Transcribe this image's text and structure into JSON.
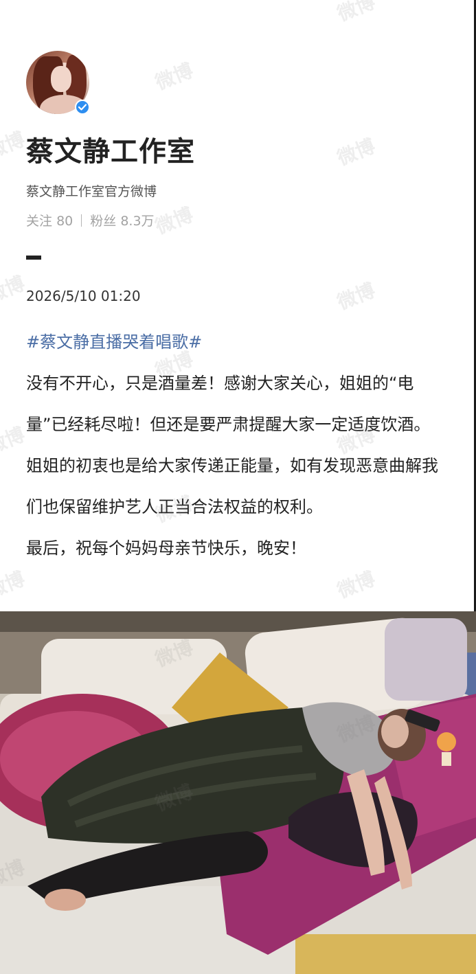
{
  "profile": {
    "name": "蔡文静工作室",
    "bio": "蔡文静工作室官方微博",
    "following_label": "关注",
    "following_count": "80",
    "fans_label": "粉丝",
    "fans_count": "8.3万"
  },
  "post": {
    "datetime": "2026/5/10 01:20",
    "hashtag": "#蔡文静直播哭着唱歌#",
    "paragraphs": [
      "没有不开心，只是酒量差！感谢大家关心，姐姐的“电量”已经耗尽啦！但还是要严肃提醒大家一定适度饮酒。",
      "姐姐的初衷也是给大家传递正能量，如有发现恶意曲解我们也保留维护艺人正当合法权益的权利。",
      "最后，祝每个妈妈母亲节快乐，晚安！"
    ]
  },
  "watermark": "微博",
  "icons": {
    "verified": "verified-badge-icon",
    "avatar": "avatar"
  },
  "colors": {
    "hashtag": "#4a6da5",
    "verified": "#2d8ef0"
  }
}
